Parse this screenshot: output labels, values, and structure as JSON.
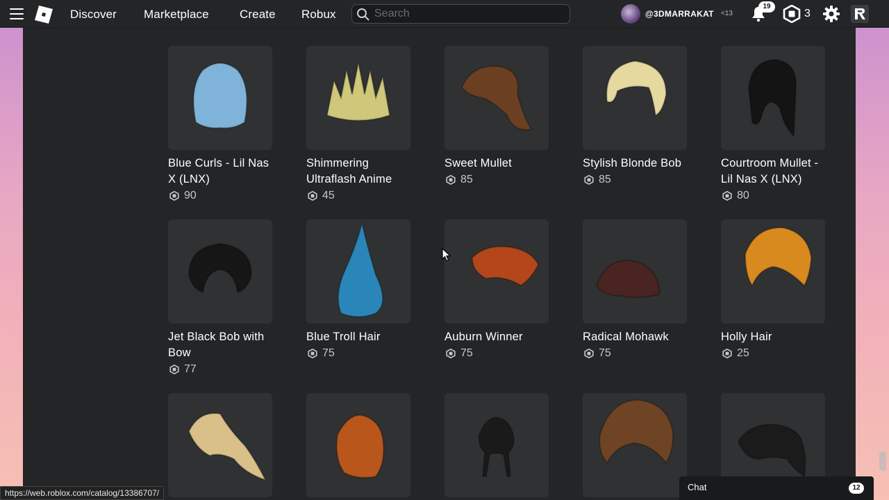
{
  "header": {
    "nav": [
      "Discover",
      "Marketplace",
      "Create",
      "Robux"
    ],
    "search_placeholder": "Search",
    "username": "@3DMARRAKAT",
    "age_label": "<13",
    "notification_count": "19",
    "robux_balance": "3",
    "icons": [
      "menu-icon",
      "roblox-logo",
      "search-icon",
      "notification-bell-icon",
      "robux-icon",
      "settings-gear-icon",
      "extension-icon"
    ]
  },
  "catalog": {
    "items": [
      {
        "name": "Blue Curls - Lil Nas X (LNX)",
        "price": "90",
        "color": "#7fb3d9"
      },
      {
        "name": "Shimmering Ultraflash Anime",
        "price": "45",
        "color": "#cfc77a"
      },
      {
        "name": "Sweet Mullet",
        "price": "85",
        "color": "#6b3f22"
      },
      {
        "name": "Stylish Blonde Bob",
        "price": "85",
        "color": "#e6d9a0"
      },
      {
        "name": "Courtroom Mullet - Lil Nas X (LNX)",
        "price": "80",
        "color": "#141414"
      },
      {
        "name": "Jet Black Bob with Bow",
        "price": "77",
        "color": "#161616"
      },
      {
        "name": "Blue Troll Hair",
        "price": "75",
        "color": "#2a86b8"
      },
      {
        "name": "Auburn Winner",
        "price": "75",
        "color": "#b4461c"
      },
      {
        "name": "Radical Mohawk",
        "price": "75",
        "color": "#4a2420"
      },
      {
        "name": "Holly Hair",
        "price": "25",
        "color": "#d98a1e"
      },
      {
        "name": "",
        "price": "",
        "color": "#d9c089"
      },
      {
        "name": "",
        "price": "",
        "color": "#b8561b"
      },
      {
        "name": "",
        "price": "",
        "color": "#1a1a1a"
      },
      {
        "name": "",
        "price": "",
        "color": "#6e4424"
      },
      {
        "name": "",
        "price": "",
        "color": "#1b1b1b"
      }
    ]
  },
  "status_url": "https://web.roblox.com/catalog/13386707/",
  "chat": {
    "label": "Chat",
    "count": "12"
  }
}
